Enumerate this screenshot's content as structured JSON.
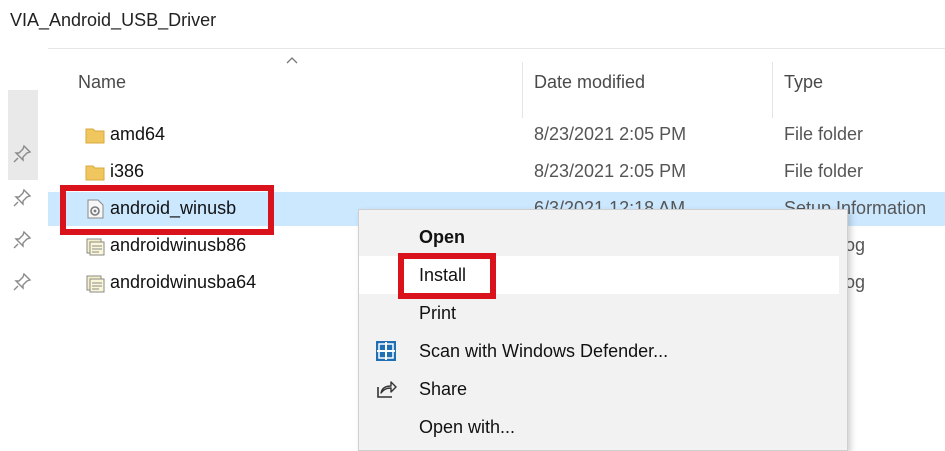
{
  "window": {
    "title": "VIA_Android_USB_Driver"
  },
  "columns": [
    {
      "label": "Name"
    },
    {
      "label": "Date modified"
    },
    {
      "label": "Type"
    }
  ],
  "files": [
    {
      "name": "amd64",
      "date": "8/23/2021 2:05 PM",
      "type": "File folder",
      "icon": "folder-icon"
    },
    {
      "name": "i386",
      "date": "8/23/2021 2:05 PM",
      "type": "File folder",
      "icon": "folder-icon"
    },
    {
      "name": "android_winusb",
      "date": "6/3/2021 12:18 AM",
      "type": "Setup Information",
      "icon": "setup-file-icon"
    },
    {
      "name": "androidwinusb86",
      "date": "",
      "type": "ty Catalog",
      "icon": "catalog-file-icon"
    },
    {
      "name": "androidwinusba64",
      "date": "",
      "type": "ty Catalog",
      "icon": "catalog-file-icon"
    }
  ],
  "context_menu": {
    "items": [
      {
        "label": "Open",
        "icon": ""
      },
      {
        "label": "Install",
        "icon": ""
      },
      {
        "label": "Print",
        "icon": ""
      },
      {
        "label": "Scan with Windows Defender...",
        "icon": "windows-defender-icon"
      },
      {
        "label": "Share",
        "icon": "share-icon"
      },
      {
        "label": "Open with...",
        "icon": ""
      }
    ]
  },
  "colors": {
    "selection": "#cce8ff",
    "highlight_box": "#d9121b",
    "folder": "#f0c75e",
    "defender": "#1f6fb5"
  }
}
